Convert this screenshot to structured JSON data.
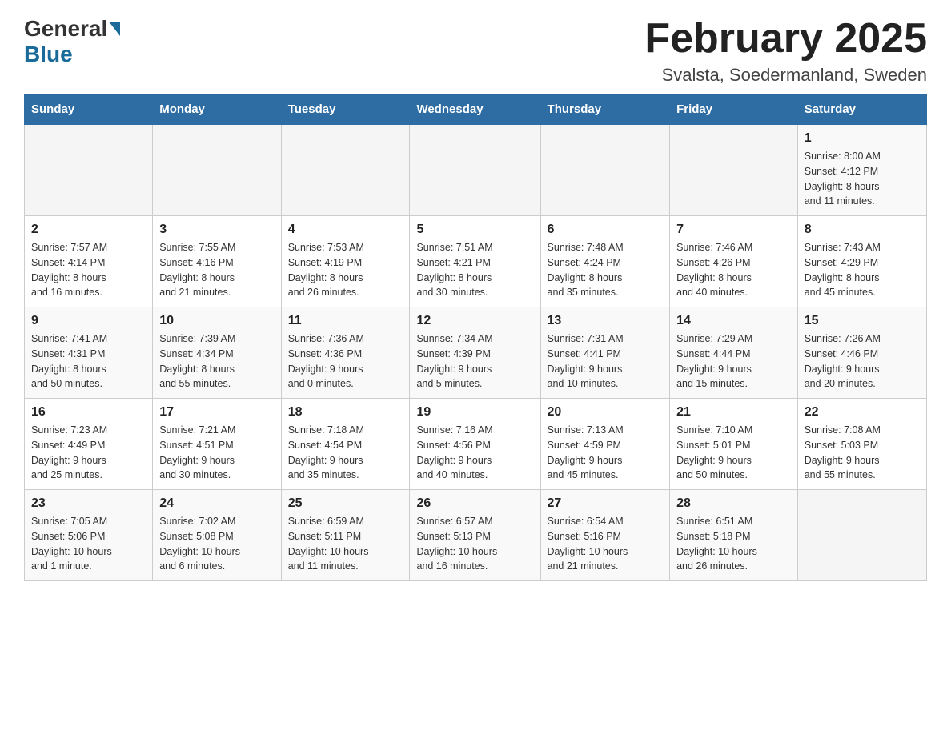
{
  "header": {
    "logo_general": "General",
    "logo_blue": "Blue",
    "month_title": "February 2025",
    "location": "Svalsta, Soedermanland, Sweden"
  },
  "weekdays": [
    "Sunday",
    "Monday",
    "Tuesday",
    "Wednesday",
    "Thursday",
    "Friday",
    "Saturday"
  ],
  "weeks": [
    {
      "days": [
        {
          "num": "",
          "info": ""
        },
        {
          "num": "",
          "info": ""
        },
        {
          "num": "",
          "info": ""
        },
        {
          "num": "",
          "info": ""
        },
        {
          "num": "",
          "info": ""
        },
        {
          "num": "",
          "info": ""
        },
        {
          "num": "1",
          "info": "Sunrise: 8:00 AM\nSunset: 4:12 PM\nDaylight: 8 hours\nand 11 minutes."
        }
      ]
    },
    {
      "days": [
        {
          "num": "2",
          "info": "Sunrise: 7:57 AM\nSunset: 4:14 PM\nDaylight: 8 hours\nand 16 minutes."
        },
        {
          "num": "3",
          "info": "Sunrise: 7:55 AM\nSunset: 4:16 PM\nDaylight: 8 hours\nand 21 minutes."
        },
        {
          "num": "4",
          "info": "Sunrise: 7:53 AM\nSunset: 4:19 PM\nDaylight: 8 hours\nand 26 minutes."
        },
        {
          "num": "5",
          "info": "Sunrise: 7:51 AM\nSunset: 4:21 PM\nDaylight: 8 hours\nand 30 minutes."
        },
        {
          "num": "6",
          "info": "Sunrise: 7:48 AM\nSunset: 4:24 PM\nDaylight: 8 hours\nand 35 minutes."
        },
        {
          "num": "7",
          "info": "Sunrise: 7:46 AM\nSunset: 4:26 PM\nDaylight: 8 hours\nand 40 minutes."
        },
        {
          "num": "8",
          "info": "Sunrise: 7:43 AM\nSunset: 4:29 PM\nDaylight: 8 hours\nand 45 minutes."
        }
      ]
    },
    {
      "days": [
        {
          "num": "9",
          "info": "Sunrise: 7:41 AM\nSunset: 4:31 PM\nDaylight: 8 hours\nand 50 minutes."
        },
        {
          "num": "10",
          "info": "Sunrise: 7:39 AM\nSunset: 4:34 PM\nDaylight: 8 hours\nand 55 minutes."
        },
        {
          "num": "11",
          "info": "Sunrise: 7:36 AM\nSunset: 4:36 PM\nDaylight: 9 hours\nand 0 minutes."
        },
        {
          "num": "12",
          "info": "Sunrise: 7:34 AM\nSunset: 4:39 PM\nDaylight: 9 hours\nand 5 minutes."
        },
        {
          "num": "13",
          "info": "Sunrise: 7:31 AM\nSunset: 4:41 PM\nDaylight: 9 hours\nand 10 minutes."
        },
        {
          "num": "14",
          "info": "Sunrise: 7:29 AM\nSunset: 4:44 PM\nDaylight: 9 hours\nand 15 minutes."
        },
        {
          "num": "15",
          "info": "Sunrise: 7:26 AM\nSunset: 4:46 PM\nDaylight: 9 hours\nand 20 minutes."
        }
      ]
    },
    {
      "days": [
        {
          "num": "16",
          "info": "Sunrise: 7:23 AM\nSunset: 4:49 PM\nDaylight: 9 hours\nand 25 minutes."
        },
        {
          "num": "17",
          "info": "Sunrise: 7:21 AM\nSunset: 4:51 PM\nDaylight: 9 hours\nand 30 minutes."
        },
        {
          "num": "18",
          "info": "Sunrise: 7:18 AM\nSunset: 4:54 PM\nDaylight: 9 hours\nand 35 minutes."
        },
        {
          "num": "19",
          "info": "Sunrise: 7:16 AM\nSunset: 4:56 PM\nDaylight: 9 hours\nand 40 minutes."
        },
        {
          "num": "20",
          "info": "Sunrise: 7:13 AM\nSunset: 4:59 PM\nDaylight: 9 hours\nand 45 minutes."
        },
        {
          "num": "21",
          "info": "Sunrise: 7:10 AM\nSunset: 5:01 PM\nDaylight: 9 hours\nand 50 minutes."
        },
        {
          "num": "22",
          "info": "Sunrise: 7:08 AM\nSunset: 5:03 PM\nDaylight: 9 hours\nand 55 minutes."
        }
      ]
    },
    {
      "days": [
        {
          "num": "23",
          "info": "Sunrise: 7:05 AM\nSunset: 5:06 PM\nDaylight: 10 hours\nand 1 minute."
        },
        {
          "num": "24",
          "info": "Sunrise: 7:02 AM\nSunset: 5:08 PM\nDaylight: 10 hours\nand 6 minutes."
        },
        {
          "num": "25",
          "info": "Sunrise: 6:59 AM\nSunset: 5:11 PM\nDaylight: 10 hours\nand 11 minutes."
        },
        {
          "num": "26",
          "info": "Sunrise: 6:57 AM\nSunset: 5:13 PM\nDaylight: 10 hours\nand 16 minutes."
        },
        {
          "num": "27",
          "info": "Sunrise: 6:54 AM\nSunset: 5:16 PM\nDaylight: 10 hours\nand 21 minutes."
        },
        {
          "num": "28",
          "info": "Sunrise: 6:51 AM\nSunset: 5:18 PM\nDaylight: 10 hours\nand 26 minutes."
        },
        {
          "num": "",
          "info": ""
        }
      ]
    }
  ]
}
